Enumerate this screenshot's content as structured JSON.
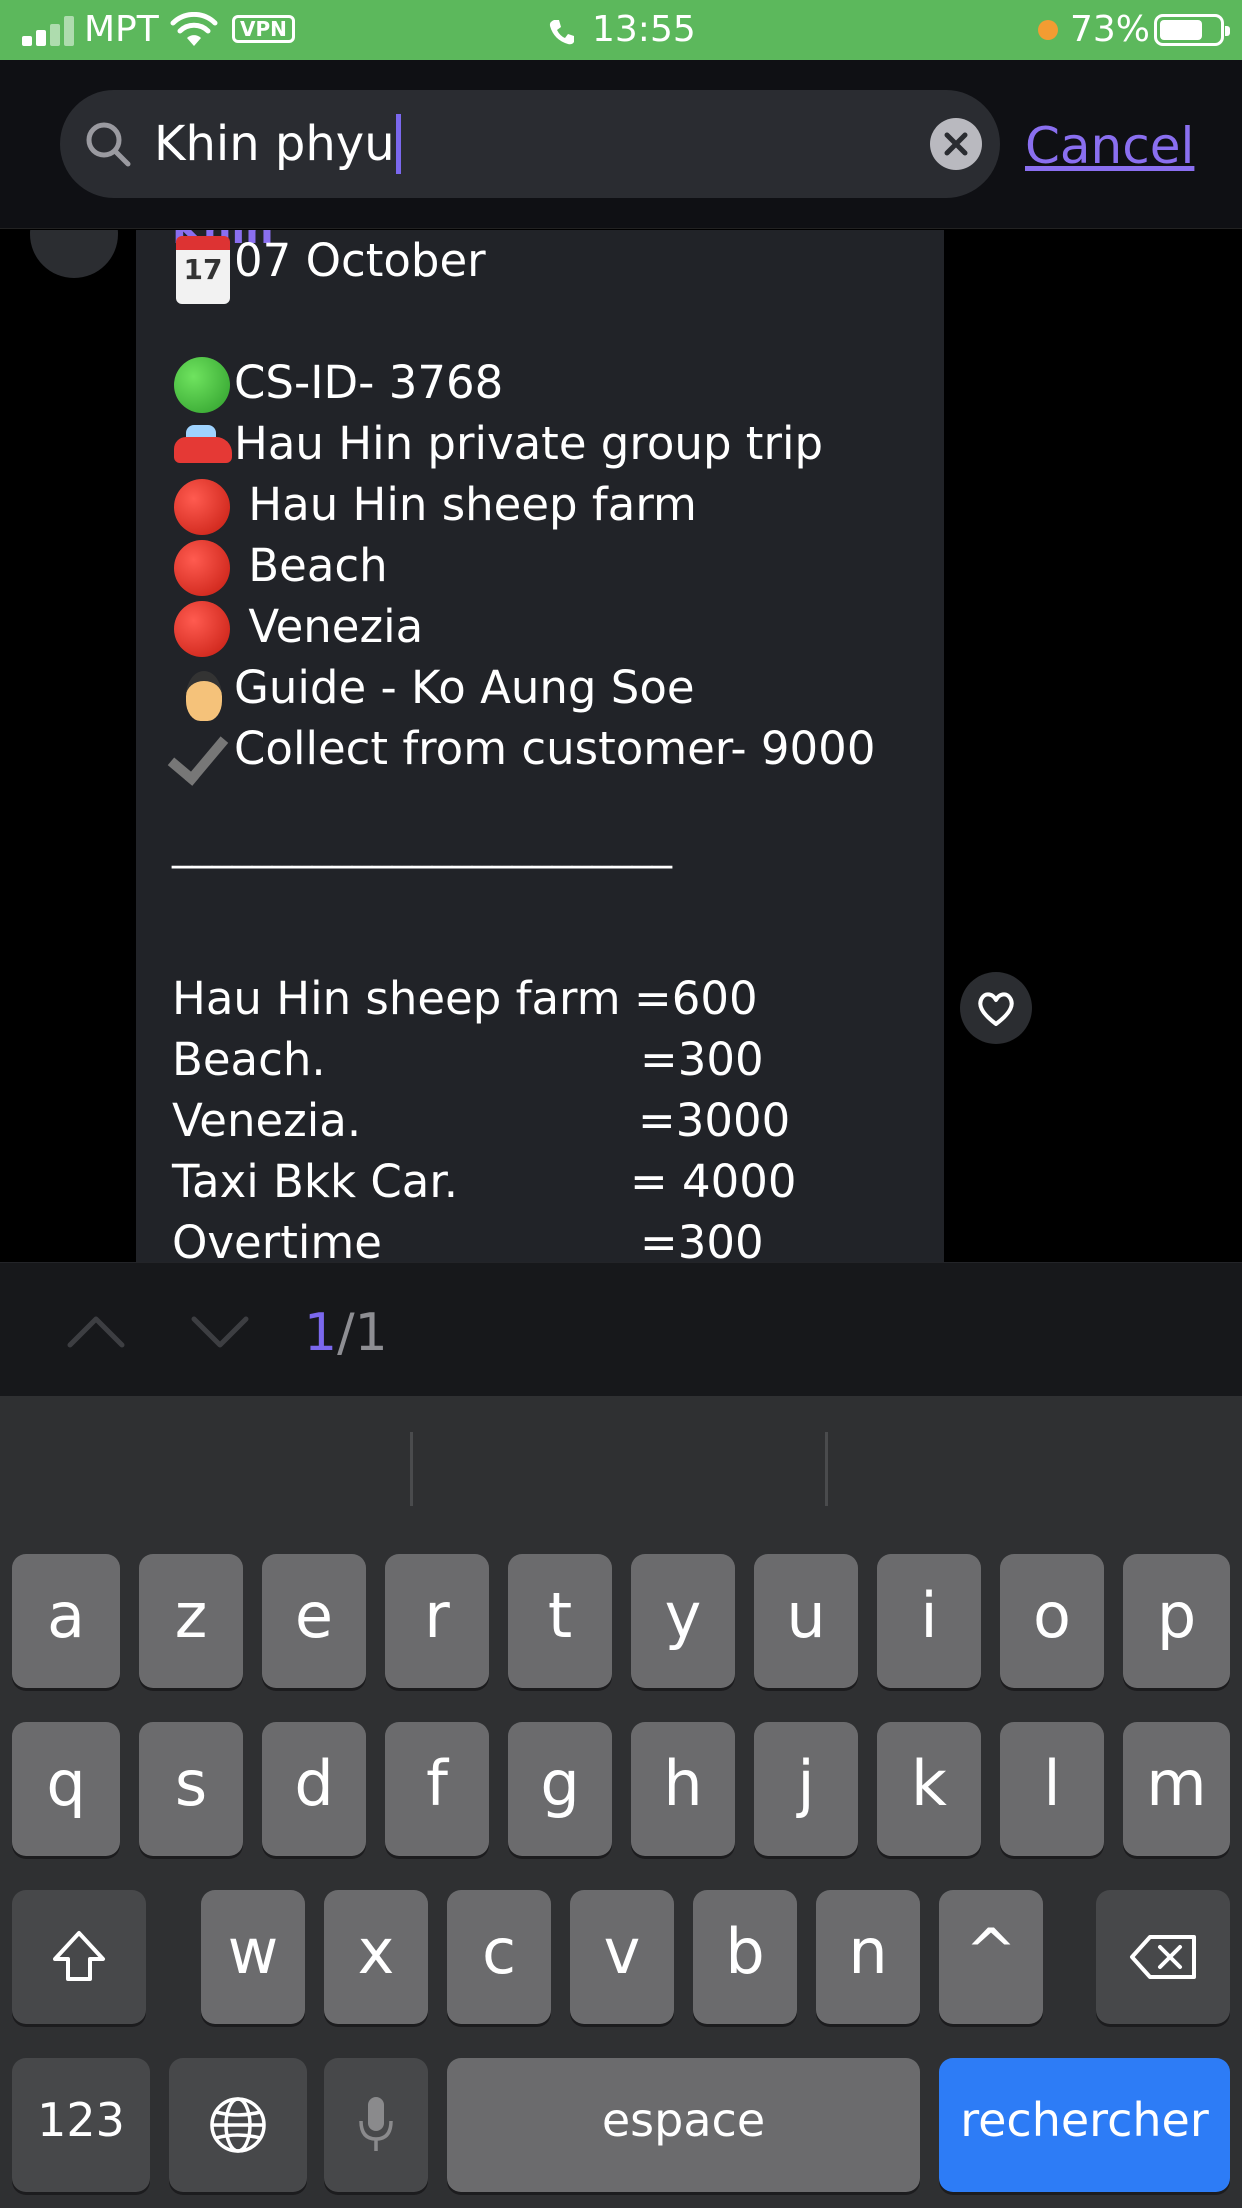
{
  "status_bar": {
    "carrier": "MPT",
    "vpn_label": "VPN",
    "time": "13:55",
    "battery_percent": "73%",
    "battery_level": 0.73,
    "color": "#5cb85c"
  },
  "search": {
    "query": "Khin phyu",
    "cancel_label": "Cancel",
    "icons": {
      "search": "search-icon",
      "clear": "clear-circle-icon"
    }
  },
  "message": {
    "date": "07 October",
    "cs_id": "CS-ID- 3768",
    "trip": "Hau Hin private group trip",
    "stops": [
      " Hau Hin sheep farm",
      " Beach",
      "Venezia"
    ],
    "guide": "Guide - Ko Aung Soe",
    "collect": "Collect from customer- 9000",
    "divider": "_________________________",
    "costs": [
      {
        "label": "Hau Hin sheep farm",
        "value": "=600"
      },
      {
        "label": "Beach.",
        "value": "=300"
      },
      {
        "label": "Venezia.",
        "value": "=3000"
      },
      {
        "label": "Taxi Bkk Car.",
        "value": "= 4000"
      },
      {
        "label": "Overtime",
        "value": "=300"
      }
    ]
  },
  "search_nav": {
    "current": "1",
    "separator": "/",
    "total": "1"
  },
  "keyboard": {
    "row1": [
      "a",
      "z",
      "e",
      "r",
      "t",
      "y",
      "u",
      "i",
      "o",
      "p"
    ],
    "row2": [
      "q",
      "s",
      "d",
      "f",
      "g",
      "h",
      "j",
      "k",
      "l",
      "m"
    ],
    "row3": [
      "w",
      "x",
      "c",
      "v",
      "b",
      "n",
      "^"
    ],
    "numbers_label": "123",
    "space_label": "espace",
    "return_label": "rechercher",
    "accent_color": "#2d7cf6"
  }
}
